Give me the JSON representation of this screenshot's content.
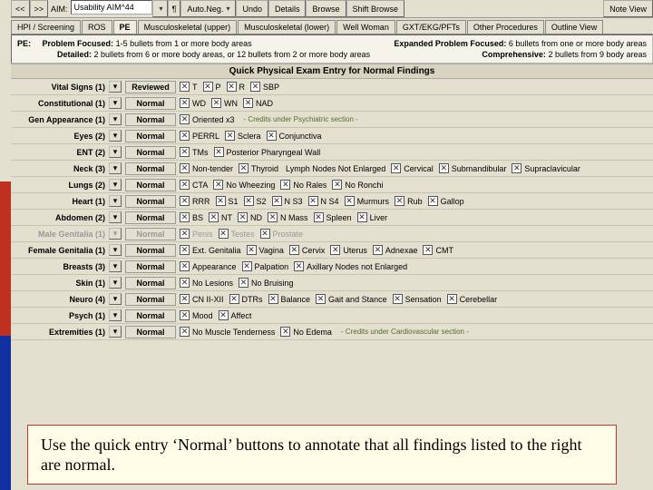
{
  "topbar": {
    "nav_prev": "<<",
    "nav_next": ">>",
    "aim_label": "AIM:",
    "aim_value": "Usability AIM^44",
    "auto_neg": "Auto.Neg.",
    "undo": "Undo",
    "details": "Details",
    "browse": "Browse",
    "shift_browse": "Shift Browse",
    "note_view": "Note View"
  },
  "tabs": [
    {
      "label": "HPI / Screening"
    },
    {
      "label": "ROS"
    },
    {
      "label": "PE",
      "active": true
    },
    {
      "label": "Musculoskeletal (upper)"
    },
    {
      "label": "Musculoskeletal (lower)"
    },
    {
      "label": "Well Woman"
    },
    {
      "label": "GXT/EKG/PFTs"
    },
    {
      "label": "Other Procedures"
    },
    {
      "label": "Outline View"
    }
  ],
  "pe_header": {
    "pe": "PE:",
    "pf_label": "Problem Focused:",
    "pf_text": "1-5 bullets from 1 or more body areas",
    "epf_label": "Expanded Problem Focused:",
    "epf_text": "6 bullets from one or more body areas",
    "det_label": "Detailed:",
    "det_text": "2 bullets from 6 or more body areas, or 12 bullets from 2 or more body areas",
    "comp_label": "Comprehensive:",
    "comp_text": "2 bullets from 9 body areas"
  },
  "section_title": "Quick Physical Exam Entry for Normal Findings",
  "normal_label": "Normal",
  "reviewed_label": "Reviewed",
  "expand_glyph": "▾",
  "rows": [
    {
      "name": "Vital Signs (1)",
      "btn": "reviewed",
      "findings": [
        "T",
        "P",
        "R",
        "SBP"
      ]
    },
    {
      "name": "Constitutional (1)",
      "btn": "normal",
      "findings": [
        "WD",
        "WN",
        "NAD"
      ]
    },
    {
      "name": "Gen Appearance (1)",
      "btn": "normal",
      "findings": [
        "Oriented x3"
      ],
      "note": "- Credits under Psychiatric section -"
    },
    {
      "name": "Eyes (2)",
      "btn": "normal",
      "findings": [
        "PERRL",
        "Sclera",
        "Conjunctiva"
      ]
    },
    {
      "name": "ENT (2)",
      "btn": "normal",
      "findings": [
        "TMs",
        "Posterior Pharyngeal Wall"
      ]
    },
    {
      "name": "Neck (3)",
      "btn": "normal",
      "findings": [
        "Non-tender",
        "Thyroid"
      ],
      "plain": "Lymph Nodes Not Enlarged",
      "extra": [
        "Cervical",
        "Submandibular",
        "Supraclavicular"
      ]
    },
    {
      "name": "Lungs (2)",
      "btn": "normal",
      "findings": [
        "CTA",
        "No Wheezing",
        "No Rales",
        "No Ronchi"
      ]
    },
    {
      "name": "Heart (1)",
      "btn": "normal",
      "findings": [
        "RRR",
        "S1",
        "S2",
        "N S3",
        "N S4",
        "Murmurs",
        "Rub",
        "Gallop"
      ]
    },
    {
      "name": "Abdomen (2)",
      "btn": "normal",
      "findings": [
        "BS",
        "NT",
        "ND",
        "N Mass",
        "Spleen",
        "Liver"
      ]
    },
    {
      "name": "Male Genitalia (1)",
      "btn": "normal",
      "findings": [
        "Penis",
        "Testes",
        "Prostate"
      ],
      "dim": true
    },
    {
      "name": "Female Genitalia (1)",
      "btn": "normal",
      "findings": [
        "Ext. Genitalia",
        "Vagina",
        "Cervix",
        "Uterus",
        "Adnexae",
        "CMT"
      ]
    },
    {
      "name": "Breasts (3)",
      "btn": "normal",
      "findings": [
        "Appearance",
        "Palpation",
        "Axillary Nodes not Enlarged"
      ]
    },
    {
      "name": "Skin (1)",
      "btn": "normal",
      "findings": [
        "No Lesions",
        "No Bruising"
      ]
    },
    {
      "name": "Neuro (4)",
      "btn": "normal",
      "findings": [
        "CN II-XII",
        "DTRs",
        "Balance",
        "Gait and Stance",
        "Sensation",
        "Cerebellar"
      ]
    },
    {
      "name": "Psych (1)",
      "btn": "normal",
      "findings": [
        "Mood",
        "Affect"
      ]
    },
    {
      "name": "Extremities (1)",
      "btn": "normal",
      "findings": [
        "No Muscle Tenderness",
        "No Edema"
      ],
      "note": "- Credits under Cardiovascular section -"
    }
  ],
  "callout": "Use the quick entry ‘Normal’ buttons to annotate that all findings listed to the right are normal."
}
